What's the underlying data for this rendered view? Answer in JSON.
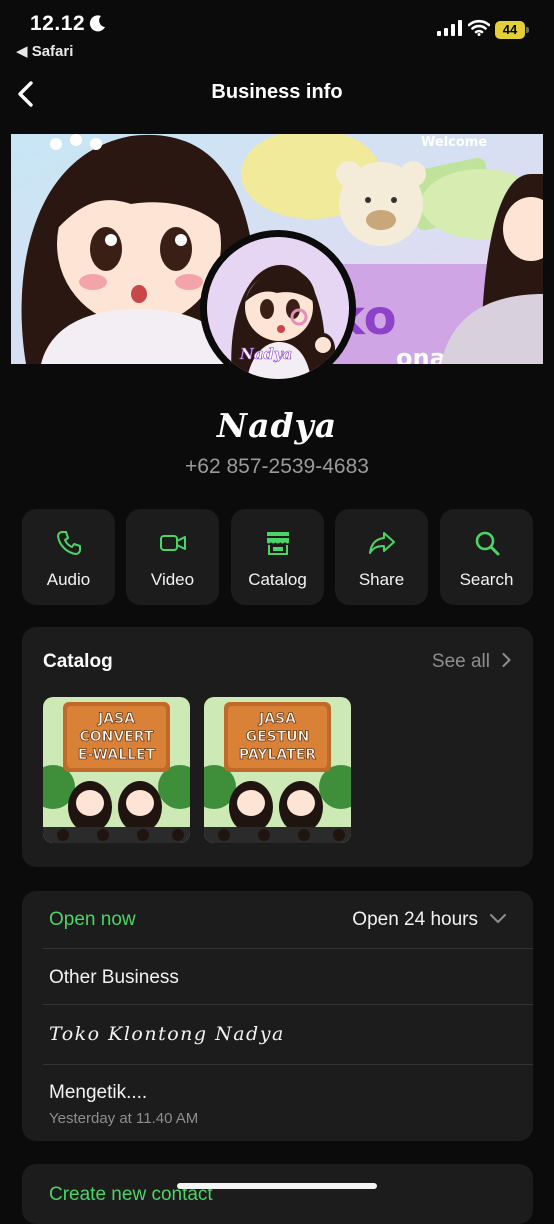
{
  "status_bar": {
    "time": "12.12",
    "back_app": "◀ Safari",
    "battery": "44"
  },
  "header": {
    "title": "Business info"
  },
  "cover": {
    "welcome_text": "Welcome",
    "shop_text": "ko",
    "shop_text_2": "ona Nadya"
  },
  "avatar": {
    "label": "Nadya"
  },
  "profile": {
    "name": "Nadya",
    "phone": "+62 857-2539-4683"
  },
  "actions": [
    {
      "label": "Audio",
      "icon": "phone-icon"
    },
    {
      "label": "Video",
      "icon": "video-icon"
    },
    {
      "label": "Catalog",
      "icon": "storefront-icon"
    },
    {
      "label": "Share",
      "icon": "share-arrow-icon"
    },
    {
      "label": "Search",
      "icon": "search-icon"
    }
  ],
  "catalog": {
    "heading": "Catalog",
    "see_all": "See all",
    "items": [
      {
        "line1": "JASA",
        "line2": "CONVERT",
        "line3": "E-WALLET"
      },
      {
        "line1": "JASA",
        "line2": "GESTUN",
        "line3": "PAYLATER"
      }
    ]
  },
  "business": {
    "status": "Open now",
    "hours": "Open 24 hours",
    "category": "Other Business",
    "description": "Toko Klontong Nadya",
    "about": "Mengetik....",
    "about_time": "Yesterday at 11.40 AM"
  },
  "contact": {
    "create_label": "Create new contact"
  },
  "colors": {
    "accent_green": "#4cd467",
    "background": "#0b0b0b",
    "card": "#1c1c1c",
    "battery": "#e3cf38"
  }
}
